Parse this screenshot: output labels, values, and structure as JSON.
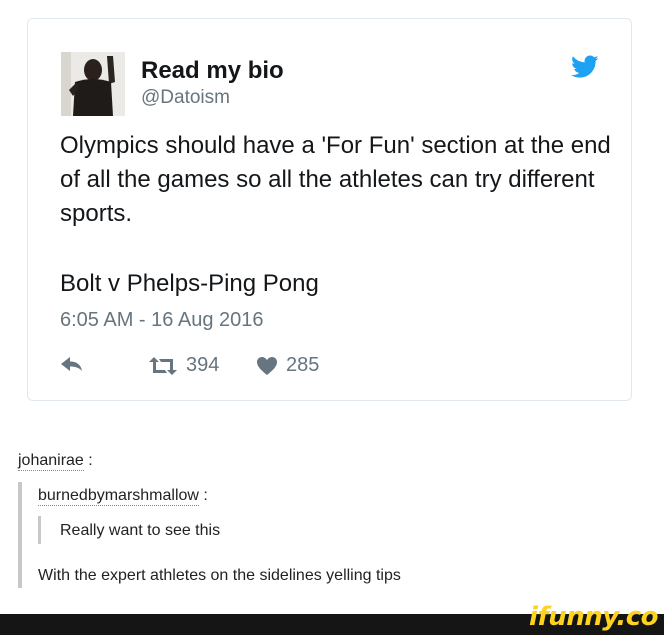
{
  "tweet": {
    "display_name": "Read my bio",
    "handle": "@Datoism",
    "text_line1": "Olympics should have a 'For Fun' section at the end of all the games so all the athletes can try different sports.",
    "text_line2": "Bolt v Phelps-Ping Pong",
    "timestamp": "6:05 AM - 16 Aug 2016",
    "retweets": "394",
    "likes": "285",
    "icons": {
      "brand": "twitter-bird-icon",
      "reply": "reply-icon",
      "retweet": "retweet-icon",
      "like": "heart-icon"
    },
    "colors": {
      "twitter_blue": "#1da1f2",
      "muted": "#66757f"
    }
  },
  "thread": {
    "user1": "johanirae",
    "user2": "burnedbymarshmallow",
    "quoted_text": "Really want to see this",
    "reply_text": "With the expert athletes on the sidelines yelling tips"
  },
  "footer": {
    "watermark": "ifunny.co"
  }
}
